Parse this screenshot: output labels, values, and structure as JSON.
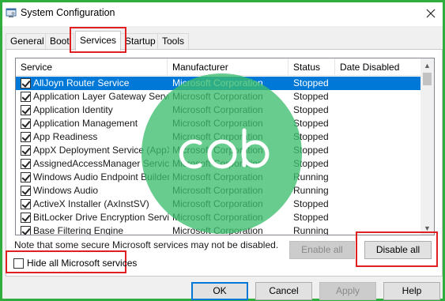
{
  "window": {
    "title": "System Configuration"
  },
  "tabs": [
    {
      "label": "General"
    },
    {
      "label": "Boot"
    },
    {
      "label": "Services"
    },
    {
      "label": "Startup"
    },
    {
      "label": "Tools"
    }
  ],
  "columns": {
    "service": "Service",
    "manufacturer": "Manufacturer",
    "status": "Status",
    "date_disabled": "Date Disabled"
  },
  "services": [
    {
      "name": "AllJoyn Router Service",
      "manufacturer": "Microsoft Corporation",
      "status": "Stopped",
      "checked": true,
      "selected": true
    },
    {
      "name": "Application Layer Gateway Service",
      "manufacturer": "Microsoft Corporation",
      "status": "Stopped",
      "checked": true
    },
    {
      "name": "Application Identity",
      "manufacturer": "Microsoft Corporation",
      "status": "Stopped",
      "checked": true
    },
    {
      "name": "Application Management",
      "manufacturer": "Microsoft Corporation",
      "status": "Stopped",
      "checked": true
    },
    {
      "name": "App Readiness",
      "manufacturer": "Microsoft Corporation",
      "status": "Stopped",
      "checked": true
    },
    {
      "name": "AppX Deployment Service (AppX...",
      "manufacturer": "Microsoft Corporation",
      "status": "Stopped",
      "checked": true
    },
    {
      "name": "AssignedAccessManager Service",
      "manufacturer": "Microsoft Corporation",
      "status": "Stopped",
      "checked": true
    },
    {
      "name": "Windows Audio Endpoint Builder",
      "manufacturer": "Microsoft Corporation",
      "status": "Running",
      "checked": true
    },
    {
      "name": "Windows Audio",
      "manufacturer": "Microsoft Corporation",
      "status": "Running",
      "checked": true
    },
    {
      "name": "ActiveX Installer (AxInstSV)",
      "manufacturer": "Microsoft Corporation",
      "status": "Stopped",
      "checked": true
    },
    {
      "name": "BitLocker Drive Encryption Service",
      "manufacturer": "Microsoft Corporation",
      "status": "Stopped",
      "checked": true
    },
    {
      "name": "Base Filtering Engine",
      "manufacturer": "Microsoft Corporation",
      "status": "Running",
      "checked": true
    }
  ],
  "note": "Note that some secure Microsoft services may not be disabled.",
  "buttons": {
    "enable_all": "Enable all",
    "disable_all": "Disable all",
    "ok": "OK",
    "cancel": "Cancel",
    "apply": "Apply",
    "help": "Help"
  },
  "hide_ms_services": {
    "label": "Hide all Microsoft services",
    "checked": false
  },
  "icons": {
    "app": "system-config-icon",
    "close": "close-icon",
    "scroll_up": "chevron-up-icon",
    "scroll_down": "chevron-down-icon",
    "watermark": "cob-logo-watermark"
  },
  "watermark": {
    "text": "cob"
  },
  "colors": {
    "frame": "#2fae3e",
    "highlight": "#e02020",
    "selection": "#0078d7"
  }
}
